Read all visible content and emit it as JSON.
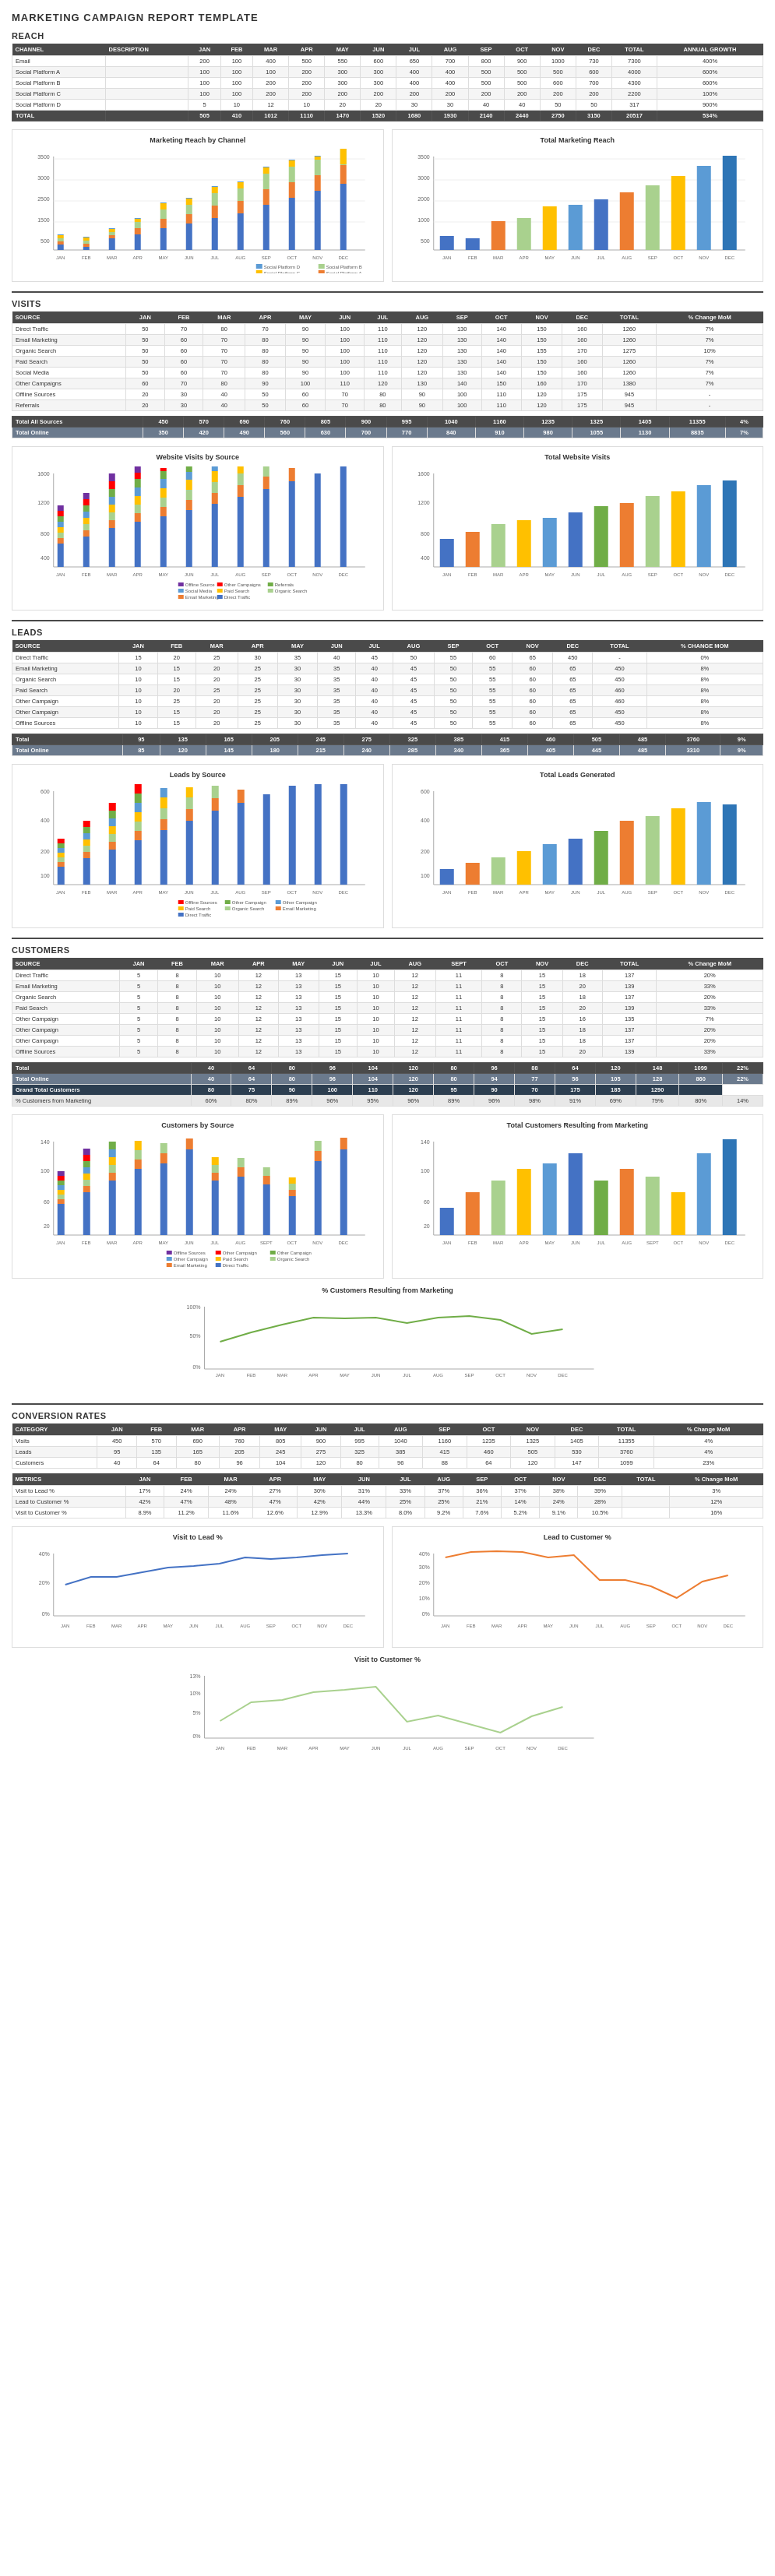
{
  "title": "MARKETING CAMPAIGN REPORT TEMPLATE",
  "sections": {
    "reach": {
      "label": "REACH",
      "columns": [
        "CHANNEL",
        "DESCRIPTION",
        "JAN",
        "FEB",
        "MAR",
        "APR",
        "MAY",
        "JUN",
        "JUL",
        "AUG",
        "SEP",
        "OCT",
        "NOV",
        "DEC",
        "TOTAL",
        "ANNUAL GROWTH"
      ],
      "rows": [
        [
          "Email",
          "",
          200,
          100,
          400,
          500,
          550,
          600,
          650,
          700,
          800,
          900,
          1000,
          730,
          7300,
          "400%"
        ],
        [
          "Social Platform A",
          "",
          100,
          100,
          100,
          200,
          300,
          300,
          400,
          400,
          500,
          500,
          500,
          600,
          4000,
          "600%"
        ],
        [
          "Social Platform B",
          "",
          100,
          100,
          200,
          200,
          300,
          300,
          400,
          400,
          500,
          500,
          600,
          700,
          4300,
          "600%"
        ],
        [
          "Social Platform C",
          "",
          100,
          100,
          200,
          200,
          200,
          200,
          200,
          200,
          200,
          200,
          200,
          200,
          2200,
          "100%"
        ],
        [
          "Social Platform D",
          "",
          5,
          10,
          12,
          10,
          20,
          20,
          30,
          30,
          40,
          40,
          50,
          50,
          317,
          "900%"
        ]
      ],
      "totals": [
        "TOTAL",
        "",
        505,
        410,
        1012,
        1110,
        1470,
        1520,
        1680,
        1930,
        2140,
        2440,
        2750,
        3150,
        20517,
        "534%"
      ],
      "chart_left_title": "Marketing Reach by Channel",
      "chart_right_title": "Total Marketing Reach",
      "colors": {
        "email": "#4472C4",
        "platformA": "#ED7D31",
        "platformB": "#A9D18E",
        "platformC": "#FFC000",
        "platformD": "#5B9BD5"
      }
    },
    "visits": {
      "label": "VISITS",
      "columns": [
        "SOURCE",
        "JAN",
        "FEB",
        "MAR",
        "APR",
        "MAY",
        "JUN",
        "JUL",
        "AUG",
        "SEP",
        "OCT",
        "NOV",
        "DEC",
        "TOTAL",
        "% Change MoM"
      ],
      "rows": [
        [
          "Direct Traffic",
          50,
          70,
          80,
          70,
          90,
          100,
          110,
          120,
          130,
          140,
          150,
          160,
          1260,
          "7%"
        ],
        [
          "Email Marketing",
          50,
          60,
          70,
          80,
          90,
          100,
          110,
          120,
          130,
          140,
          150,
          160,
          1260,
          "7%"
        ],
        [
          "Organic Search",
          50,
          60,
          70,
          80,
          90,
          100,
          110,
          120,
          130,
          140,
          155,
          170,
          1275,
          "10%"
        ],
        [
          "Paid Search",
          50,
          60,
          70,
          80,
          90,
          100,
          110,
          120,
          130,
          140,
          150,
          160,
          1260,
          "7%"
        ],
        [
          "Social Media",
          50,
          60,
          70,
          80,
          90,
          100,
          110,
          120,
          130,
          140,
          150,
          160,
          1260,
          "7%"
        ],
        [
          "Other Campaigns",
          60,
          70,
          80,
          90,
          100,
          110,
          120,
          130,
          140,
          150,
          160,
          170,
          1380,
          "7%"
        ],
        [
          "Offline Sources",
          20,
          30,
          40,
          50,
          60,
          70,
          80,
          90,
          100,
          110,
          120,
          175,
          945,
          "-"
        ],
        [
          "Referrals",
          20,
          30,
          40,
          50,
          60,
          70,
          80,
          90,
          100,
          110,
          120,
          175,
          945,
          "-"
        ]
      ],
      "totals_label": "Total All Sources",
      "totals": [
        450,
        570,
        690,
        760,
        805,
        900,
        995,
        1040,
        1160,
        1235,
        1325,
        1405,
        11355,
        "4%"
      ],
      "online_label": "Total Online",
      "online": [
        350,
        420,
        490,
        560,
        630,
        700,
        770,
        840,
        910,
        980,
        1055,
        1130,
        8835,
        "7%"
      ],
      "chart_left_title": "Website Visits by Source",
      "chart_right_title": "Total Website Visits"
    },
    "leads": {
      "label": "LEADS",
      "columns": [
        "SOURCE",
        "JAN",
        "FEB",
        "MAR",
        "APR",
        "MAY",
        "JUN",
        "JUL",
        "AUG",
        "SEP",
        "OCT",
        "NOV",
        "DEC",
        "TOTAL",
        "% CHANGE MOM"
      ],
      "rows": [
        [
          "Direct Traffic",
          15,
          20,
          25,
          30,
          35,
          40,
          45,
          50,
          55,
          60,
          65,
          450,
          "-",
          "0%"
        ],
        [
          "Email Marketing",
          10,
          15,
          20,
          25,
          30,
          35,
          40,
          45,
          50,
          55,
          60,
          65,
          450,
          "8%"
        ],
        [
          "Organic Search",
          10,
          15,
          20,
          25,
          30,
          35,
          40,
          45,
          50,
          55,
          60,
          65,
          450,
          "8%"
        ],
        [
          "Paid Search",
          10,
          20,
          25,
          25,
          30,
          35,
          40,
          45,
          50,
          55,
          60,
          65,
          460,
          "8%"
        ],
        [
          "Other Campaign",
          10,
          25,
          20,
          25,
          30,
          35,
          40,
          45,
          50,
          55,
          60,
          65,
          460,
          "8%"
        ],
        [
          "Other Campaign",
          10,
          15,
          20,
          25,
          30,
          35,
          40,
          45,
          50,
          55,
          60,
          65,
          450,
          "8%"
        ],
        [
          "Offline Sources",
          10,
          15,
          20,
          25,
          30,
          35,
          40,
          45,
          50,
          55,
          60,
          65,
          450,
          "8%"
        ]
      ],
      "total_row": [
        "Total",
        95,
        135,
        165,
        205,
        245,
        275,
        325,
        385,
        415,
        460,
        505,
        485,
        3760,
        "9%"
      ],
      "online_row": [
        "Total Online",
        85,
        120,
        145,
        180,
        215,
        240,
        285,
        340,
        365,
        405,
        445,
        485,
        3310,
        "9%"
      ],
      "chart_left_title": "Leads by Source",
      "chart_right_title": "Total Leads Generated"
    },
    "customers": {
      "label": "CUSTOMERS",
      "columns": [
        "SOURCE",
        "JAN",
        "FEB",
        "MAR",
        "APR",
        "MAY",
        "JUN",
        "JUL",
        "AUG",
        "SEP",
        "OCT",
        "NOV",
        "DEC",
        "TOTAL",
        "% Change MoM"
      ],
      "rows": [
        [
          "Direct Traffic",
          5,
          8,
          10,
          12,
          13,
          15,
          10,
          12,
          11,
          8,
          15,
          18,
          137,
          "20%"
        ],
        [
          "Email Marketing",
          5,
          8,
          10,
          12,
          13,
          15,
          10,
          12,
          11,
          8,
          15,
          20,
          139,
          "33%"
        ],
        [
          "Organic Search",
          5,
          8,
          10,
          12,
          13,
          15,
          10,
          12,
          11,
          8,
          15,
          18,
          137,
          "20%"
        ],
        [
          "Paid Search",
          5,
          8,
          10,
          12,
          13,
          15,
          10,
          12,
          11,
          8,
          15,
          20,
          139,
          "33%"
        ],
        [
          "Other Campaign",
          5,
          8,
          10,
          12,
          13,
          15,
          10,
          12,
          11,
          8,
          15,
          16,
          135,
          "7%"
        ],
        [
          "Other Campaign",
          5,
          8,
          10,
          12,
          13,
          15,
          10,
          12,
          11,
          8,
          15,
          18,
          137,
          "20%"
        ],
        [
          "Other Campaign",
          5,
          8,
          10,
          12,
          13,
          15,
          10,
          12,
          11,
          8,
          15,
          18,
          137,
          "20%"
        ],
        [
          "Offline Sources",
          5,
          8,
          10,
          12,
          13,
          15,
          10,
          12,
          11,
          8,
          15,
          20,
          139,
          "33%"
        ]
      ],
      "total_row": [
        "Total",
        40,
        64,
        80,
        96,
        104,
        120,
        80,
        96,
        88,
        64,
        120,
        148,
        1099,
        "22%"
      ],
      "online_row": [
        "Total Online",
        40,
        64,
        80,
        96,
        104,
        120,
        80,
        94,
        77,
        56,
        105,
        128,
        860,
        "22%"
      ],
      "grand_total": [
        "Grand Total Customers",
        80,
        75,
        90,
        100,
        110,
        120,
        95,
        90,
        70,
        175,
        185,
        1290,
        ""
      ],
      "pct_marketing": [
        "% Customers from Marketing",
        "60%",
        "80%",
        "89%",
        "96%",
        "95%",
        "96%",
        "89%",
        "96%",
        "98%",
        "91%",
        "69%",
        "79%",
        "80%",
        "14%"
      ],
      "chart_left_title": "Customers by Source",
      "chart_right_title": "Total Customers Resulting from Marketing",
      "chart_pct_title": "% Customers Resulting from Marketing"
    },
    "conversion": {
      "label": "CONVERSION RATES",
      "category_cols": [
        "CATEGORY",
        "JAN",
        "FEB",
        "MAR",
        "APR",
        "MAY",
        "JUN",
        "JUL",
        "AUG",
        "SEP",
        "OCT",
        "NOV",
        "DEC",
        "TOTAL",
        "% Change MoM"
      ],
      "category_rows": [
        [
          "Visits",
          450,
          570,
          690,
          760,
          805,
          900,
          995,
          1040,
          1160,
          1235,
          1325,
          1405,
          11355,
          "4%"
        ],
        [
          "Leads",
          95,
          135,
          165,
          205,
          245,
          275,
          325,
          385,
          415,
          460,
          505,
          530,
          3760,
          "4%"
        ],
        [
          "Customers",
          40,
          64,
          80,
          96,
          104,
          120,
          80,
          96,
          88,
          64,
          120,
          147,
          1099,
          "23%"
        ]
      ],
      "metrics_cols": [
        "METRICS",
        "JAN",
        "FEB",
        "MAR",
        "APR",
        "MAY",
        "JUN",
        "JUL",
        "AUG",
        "SEP",
        "OCT",
        "NOV",
        "DEC",
        "TOTAL",
        "% Change MoM"
      ],
      "metrics_rows": [
        [
          "Visit to Lead %",
          "17%",
          "24%",
          "24%",
          "27%",
          "30%",
          "31%",
          "33%",
          "37%",
          "36%",
          "37%",
          "38%",
          "39%",
          "",
          "3%"
        ],
        [
          "Lead to Customer %",
          "42%",
          "47%",
          "48%",
          "47%",
          "42%",
          "44%",
          "25%",
          "25%",
          "21%",
          "14%",
          "24%",
          "28%",
          "",
          "12%"
        ],
        [
          "Visit to Customer %",
          "8.9%",
          "11.2%",
          "11.6%",
          "12.6%",
          "12.9%",
          "13.3%",
          "8.0%",
          "9.2%",
          "7.6%",
          "5.2%",
          "9.1%",
          "10.5%",
          "",
          "16%"
        ]
      ],
      "chart_left_title": "Visit to Lead %",
      "chart_right_title": "Lead to Customer %",
      "chart_bottom_title": "Visit to Customer %"
    }
  }
}
